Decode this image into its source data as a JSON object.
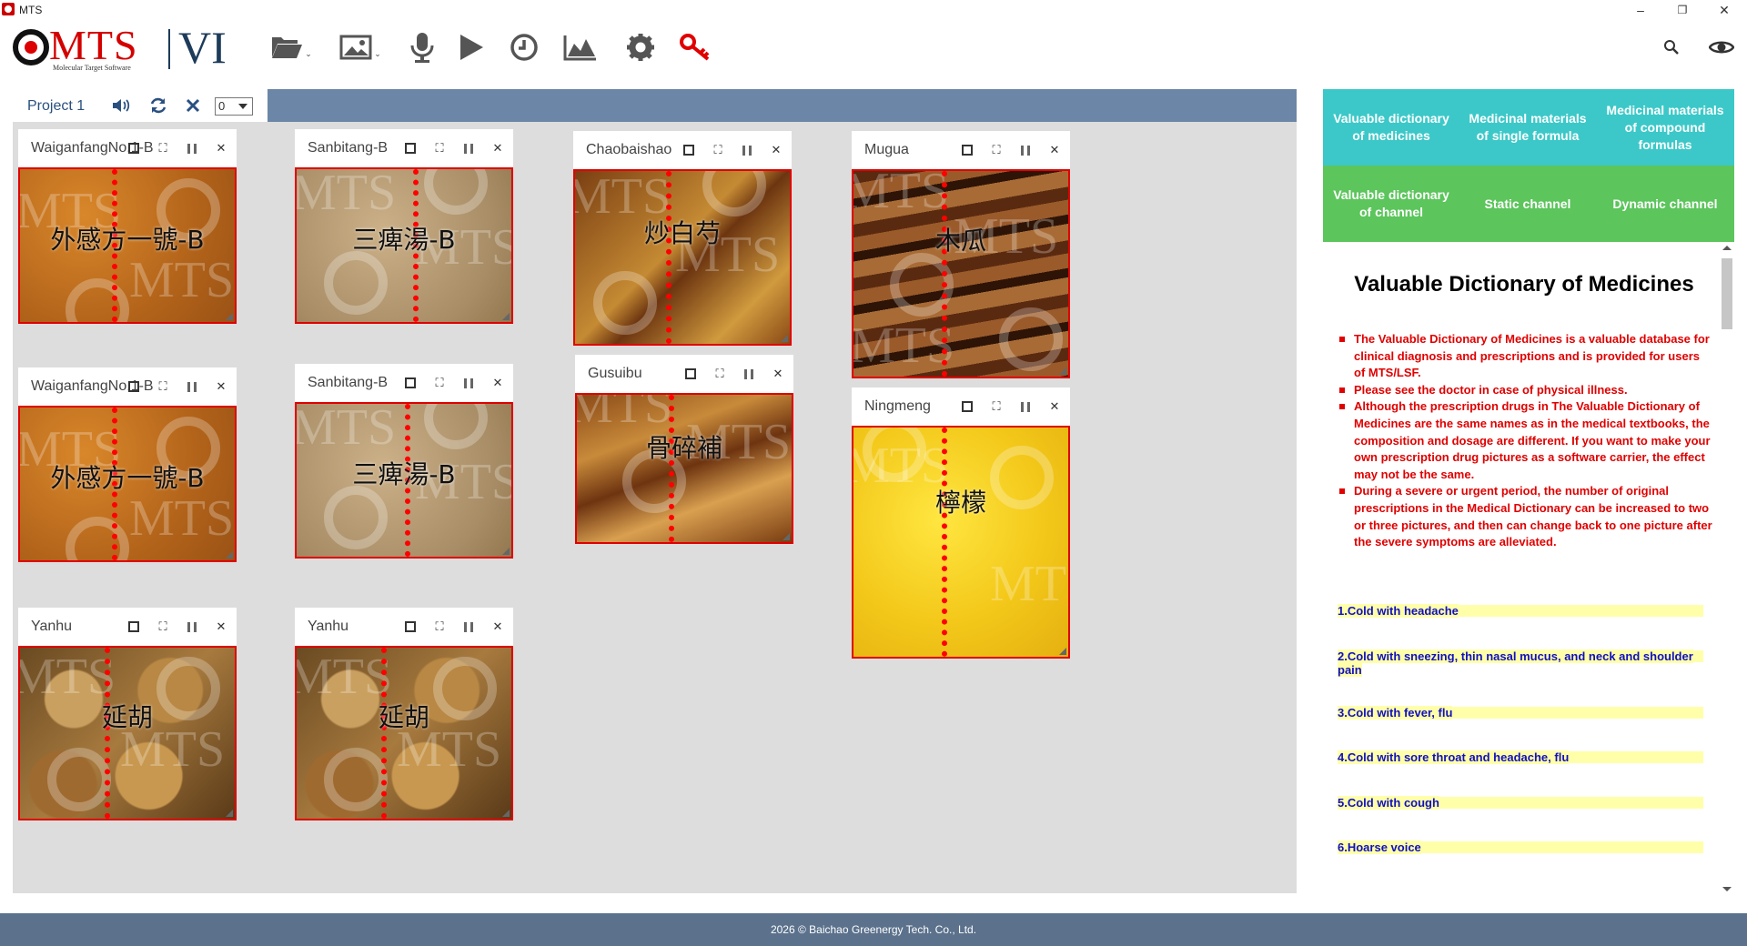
{
  "window": {
    "title": "MTS",
    "minimize": "–",
    "restore": "❐",
    "close": "✕"
  },
  "brand": {
    "wordmark": "MTS",
    "tagline": "Molecular Target Software",
    "version": "VI"
  },
  "toolbar": {
    "icons": [
      "open-folder-icon",
      "image-icon",
      "microphone-icon",
      "play-icon",
      "clock-icon",
      "chart-icon",
      "gear-icon",
      "key-icon"
    ],
    "caret": "⌄"
  },
  "project": {
    "name": "Project 1",
    "select_value": "0"
  },
  "panels": [
    {
      "title": "WaiganfangNo.1-B",
      "label": "外感方一號-B"
    },
    {
      "title": "Sanbitang-B",
      "label": "三痺湯-B"
    },
    {
      "title": "Chaobaishao",
      "label": "炒白芍"
    },
    {
      "title": "Mugua",
      "label": "木瓜"
    },
    {
      "title": "WaiganfangNo.1-B",
      "label": "外感方一號-B"
    },
    {
      "title": "Sanbitang-B",
      "label": "三痺湯-B"
    },
    {
      "title": "Gusuibu",
      "label": "骨碎補"
    },
    {
      "title": "Ningmeng",
      "label": "檸檬"
    },
    {
      "title": "Yanhu",
      "label": "延胡"
    },
    {
      "title": "Yanhu",
      "label": "延胡"
    }
  ],
  "tabs": [
    "Valuable dictionary of medicines",
    "Medicinal materials of single formula",
    "Medicinal materials of compound formulas",
    "Valuable dictionary of channel",
    "Static channel",
    "Dynamic channel"
  ],
  "dictionary": {
    "title": "Valuable Dictionary of Medicines",
    "notes": [
      "The Valuable Dictionary of Medicines is a valuable database for clinical diagnosis and prescriptions and is provided for users of MTS/LSF.",
      "Please see the doctor in case of physical illness.",
      "Although the prescription drugs in The Valuable Dictionary of Medicines are the same names as in the medical textbooks, the composition and dosage are different. If you want to make your own prescription drug pictures as a software carrier, the effect may not be the same.",
      "During a severe or urgent period, the number of original prescriptions in the Medical Dictionary can be increased to two or three pictures, and then can change back to one picture after the severe symptoms are alleviated."
    ],
    "entries": [
      "1.Cold with headache",
      "2.Cold with sneezing, thin nasal mucus, and neck and shoulder pain",
      "3.Cold with fever, flu",
      "4.Cold with sore throat and headache, flu",
      "5.Cold with cough",
      "6.Hoarse voice"
    ]
  },
  "footer": "2026 © Baichao Greenergy Tech. Co., Ltd.",
  "colors": {
    "teal": "#3cc8c8",
    "green": "#5cc55c",
    "note_red": "#e00000",
    "entry_blue": "#1010c0",
    "entry_highlight": "#ffffaa",
    "footer": "#5b718c",
    "project_bar": "#6b86a6"
  }
}
